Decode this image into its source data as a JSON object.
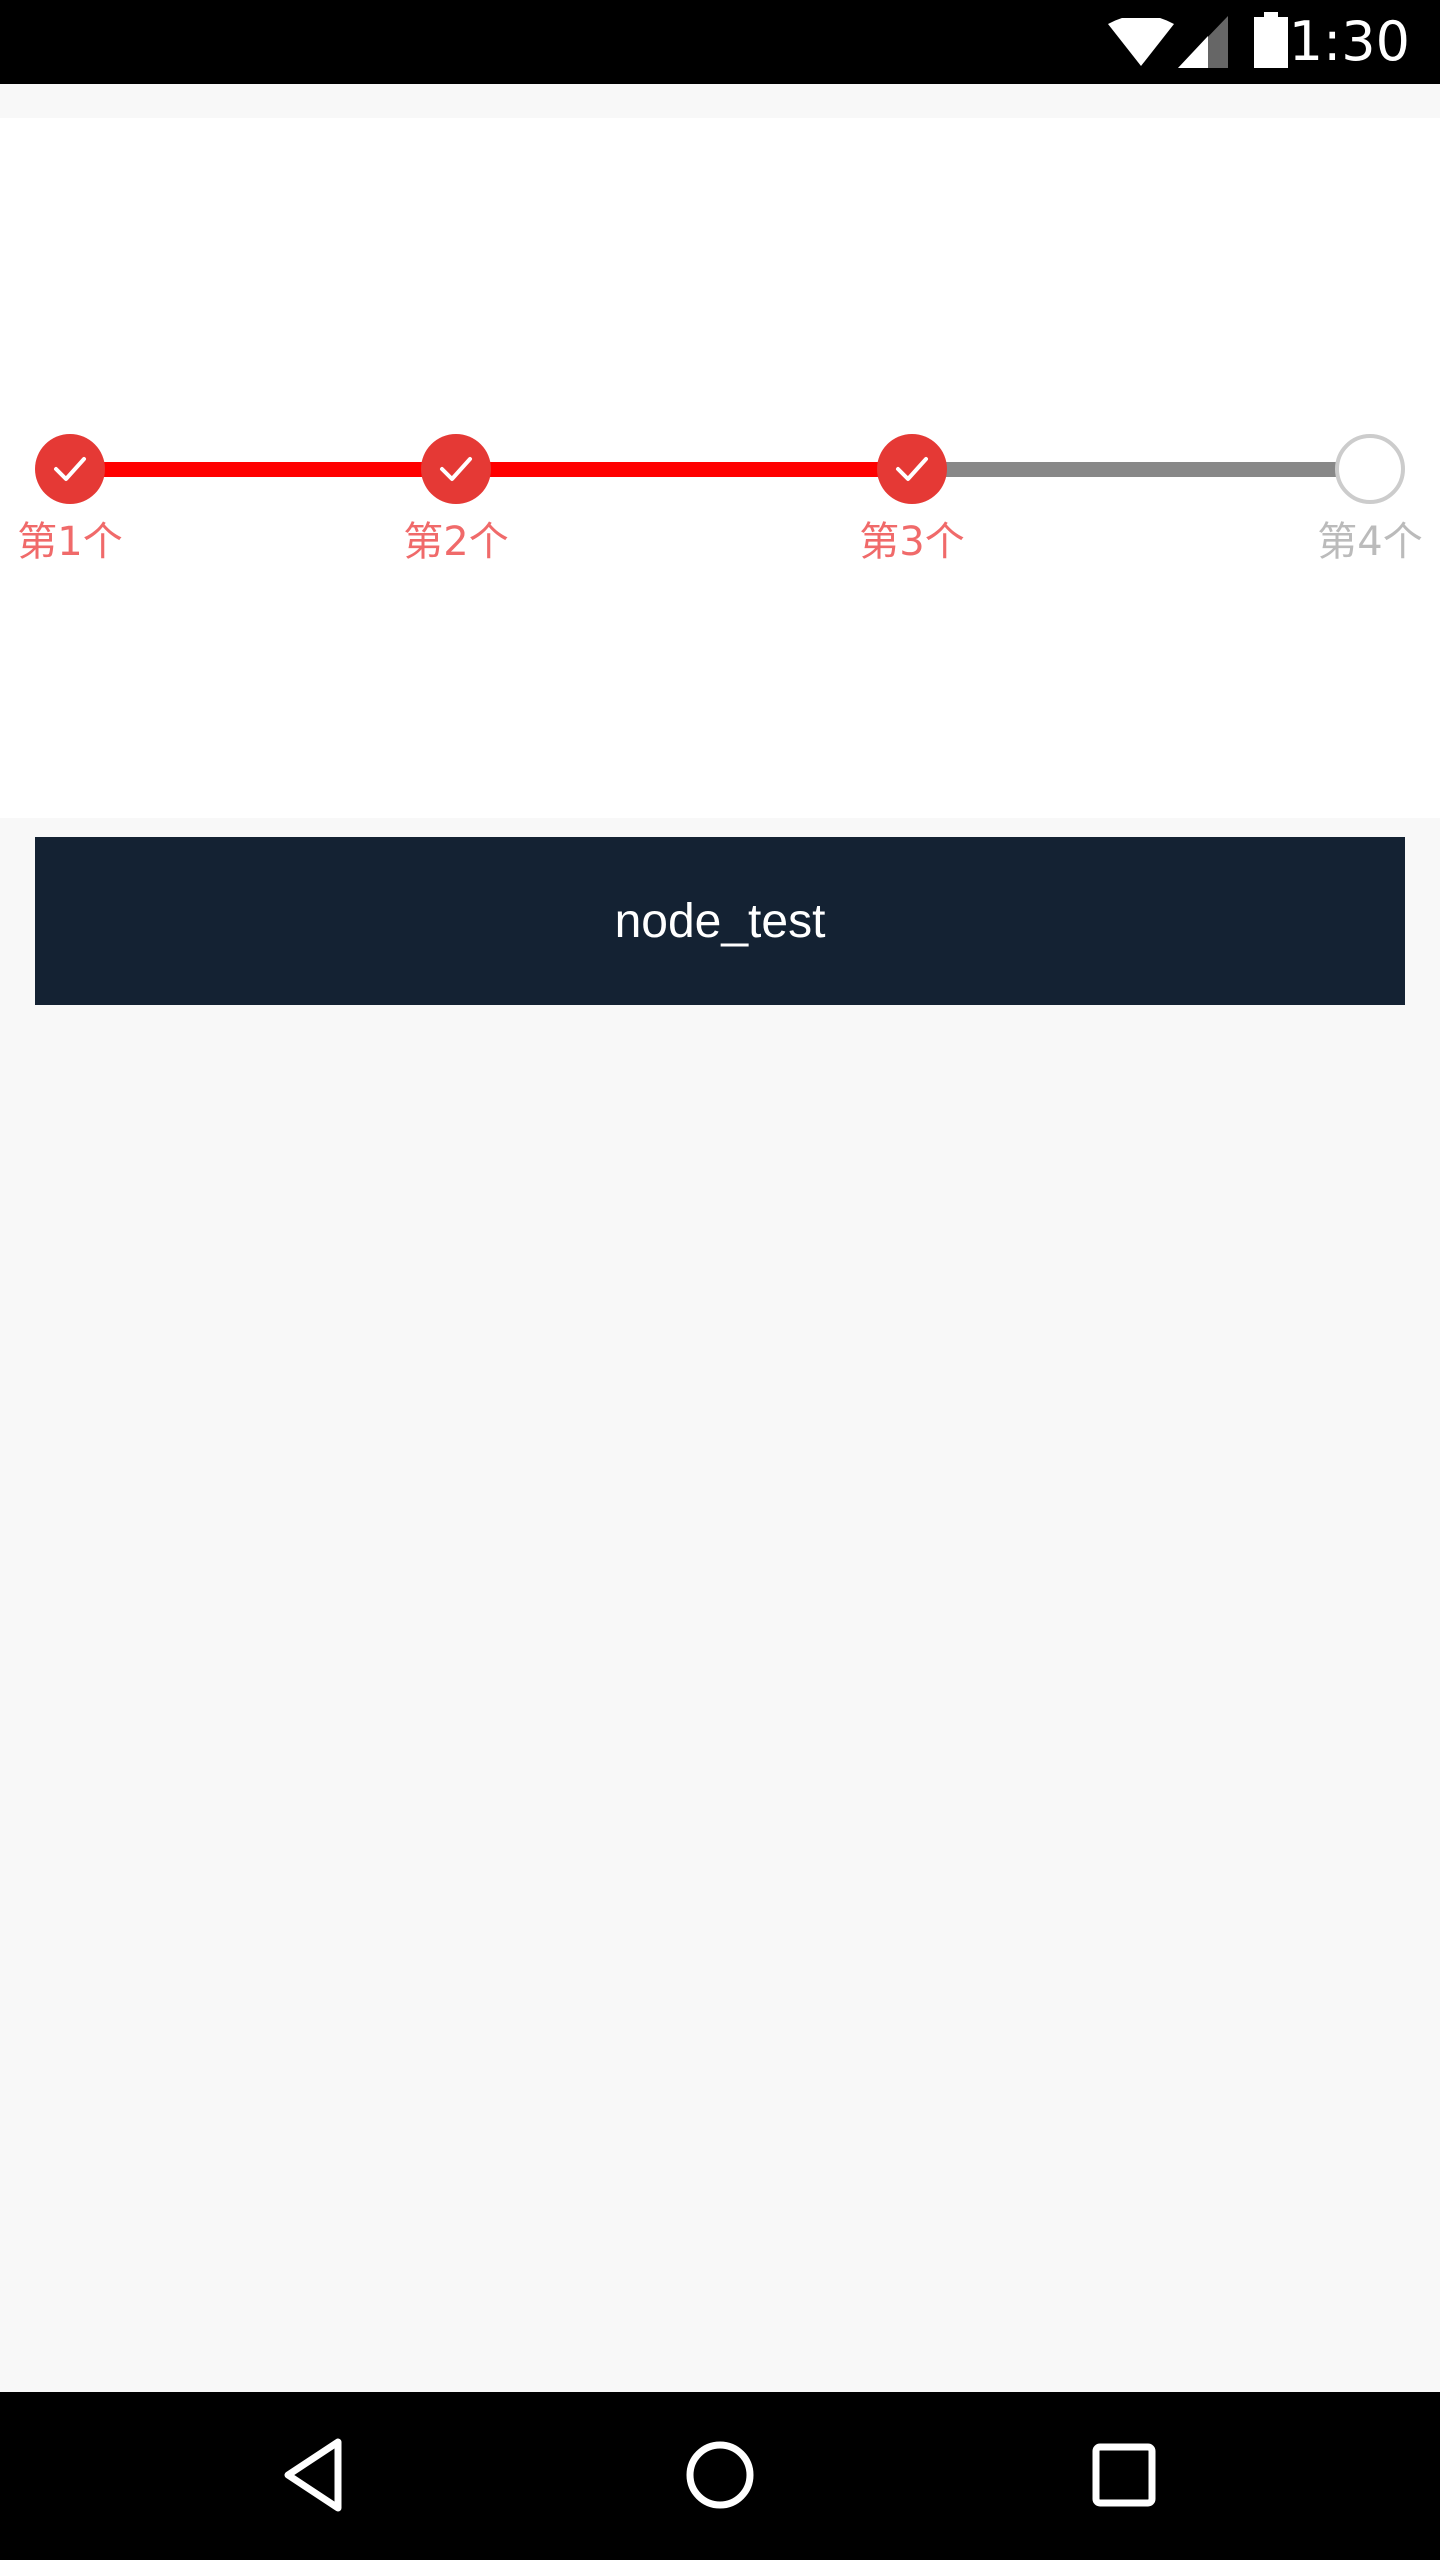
{
  "status_bar": {
    "time": "1:30",
    "icons": [
      "wifi-icon",
      "cell-signal-icon",
      "battery-icon"
    ]
  },
  "stepper": {
    "colors": {
      "done": "#e53935",
      "line_done": "#ff0000",
      "line_todo": "#888888",
      "label_done": "#f06a6a",
      "label_todo": "#bbbbbb"
    },
    "steps": [
      {
        "label": "第1个",
        "state": "done"
      },
      {
        "label": "第2个",
        "state": "done"
      },
      {
        "label": "第3个",
        "state": "done"
      },
      {
        "label": "第4个",
        "state": "todo"
      }
    ]
  },
  "main": {
    "button_label": "node_test",
    "button_color": "#142233"
  },
  "nav_bar": {
    "icons": [
      "back-icon",
      "home-icon",
      "recents-icon"
    ]
  }
}
